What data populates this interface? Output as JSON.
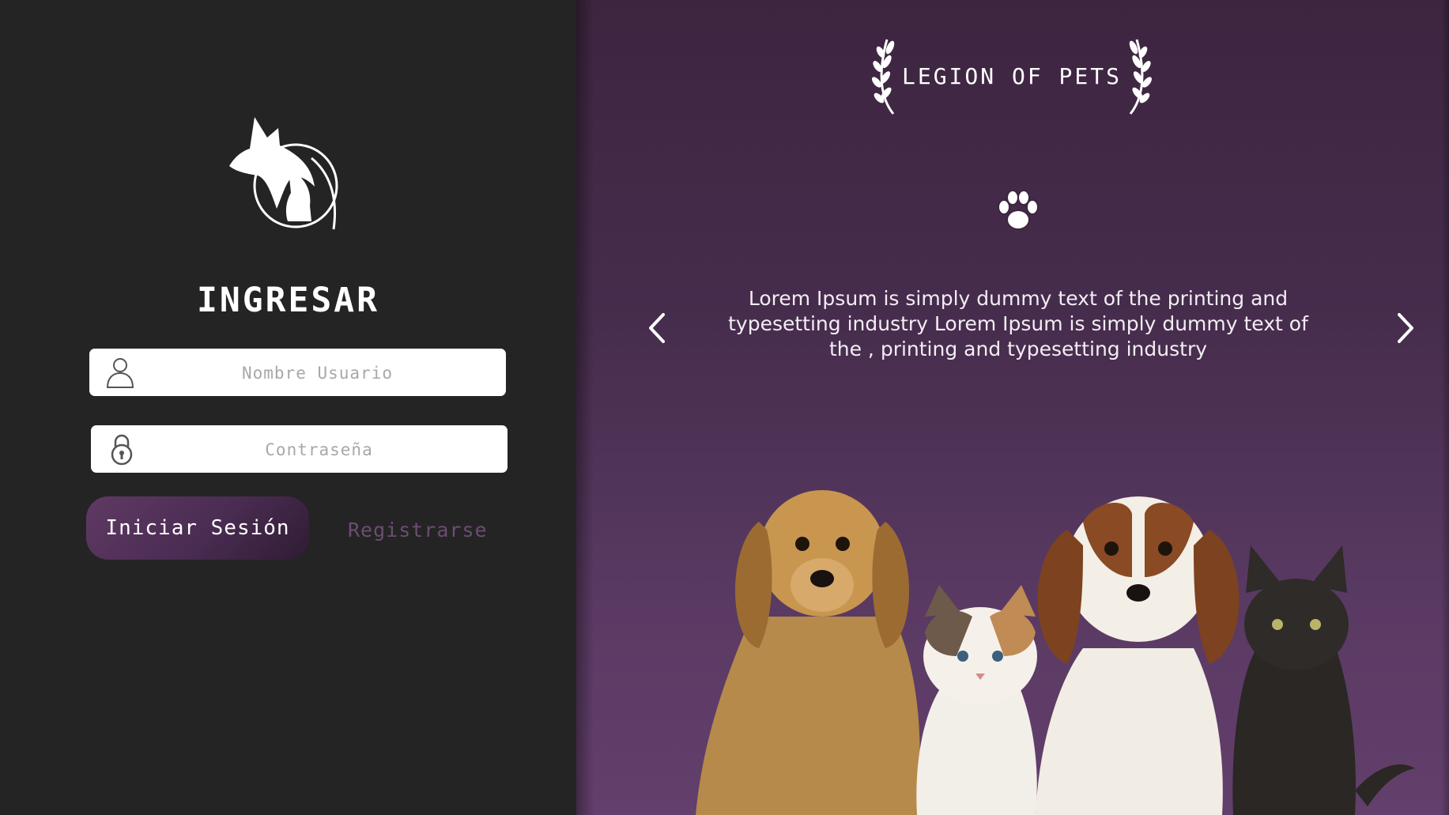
{
  "login": {
    "title": "INGRESAR",
    "username_placeholder": "Nombre Usuario",
    "password_placeholder": "Contraseña",
    "login_button": "Iniciar Sesión",
    "register_link": "Registrarse"
  },
  "brand": {
    "name": "LEGION OF PETS"
  },
  "carousel": {
    "text": "Lorem Ipsum is simply dummy text of the printing and typesetting industry Lorem Ipsum is simply dummy text of the , printing and typesetting industry"
  },
  "icons": {
    "logo": "dog-cat-rabbit-logo-icon",
    "user": "user-icon",
    "lock": "lock-icon",
    "laurel": "laurel-icon",
    "paw": "paw-icon",
    "prev": "chevron-left-icon",
    "next": "chevron-right-icon"
  },
  "colors": {
    "left_bg": "#242424",
    "right_bg_top": "#3d2540",
    "right_bg_bottom": "#633f6c",
    "button_bg": "#4a2c52",
    "link_color": "#6b4d73"
  }
}
